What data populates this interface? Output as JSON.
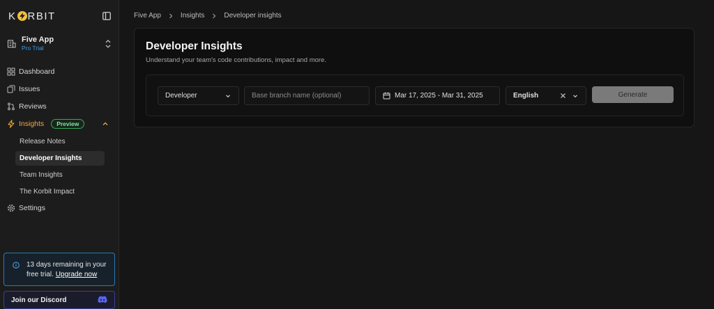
{
  "brand": {
    "logo_left": "K",
    "logo_right": "RBIT"
  },
  "workspace": {
    "name": "Five App",
    "plan": "Pro Trial"
  },
  "nav": {
    "dashboard": "Dashboard",
    "issues": "Issues",
    "reviews": "Reviews",
    "insights": "Insights",
    "insights_badge": "Preview",
    "settings": "Settings"
  },
  "insights_sub": [
    "Release Notes",
    "Developer Insights",
    "Team Insights",
    "The Korbit Impact"
  ],
  "trial": {
    "message": "13 days remaining in your free trial.",
    "link": "Upgrade now"
  },
  "discord": {
    "label": "Join our Discord"
  },
  "breadcrumb": [
    "Five App",
    "Insights",
    "Developer insights"
  ],
  "page": {
    "title": "Developer Insights",
    "subtitle": "Understand your team's code contributions, impact and more."
  },
  "form": {
    "developer_select": "Developer",
    "branch_placeholder": "Base branch name (optional)",
    "date_range": "Mar 17, 2025 - Mar 31, 2025",
    "language": "English",
    "generate_label": "Generate"
  },
  "colors": {
    "accent": "#f2a93b",
    "badge": "#3aa85a",
    "info": "#2b7bb5",
    "discord": "#5865f2"
  }
}
